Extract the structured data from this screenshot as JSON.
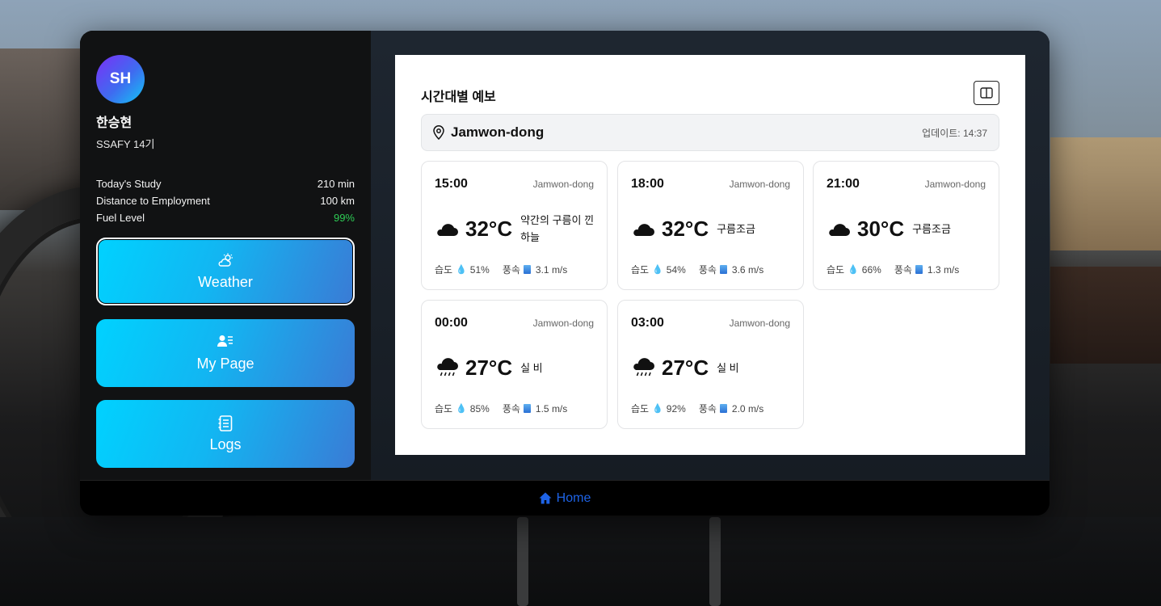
{
  "user": {
    "initials": "SH",
    "name": "한승현",
    "subtitle": "SSAFY 14기"
  },
  "stats": [
    {
      "label": "Today's Study",
      "value": "210 min"
    },
    {
      "label": "Distance to Employment",
      "value": "100 km"
    },
    {
      "label": "Fuel Level",
      "value": "99%",
      "color": "#2ecc55"
    }
  ],
  "nav": [
    {
      "label": "Weather",
      "icon": "cloud-sun-icon",
      "active": true
    },
    {
      "label": "My Page",
      "icon": "user-list-icon",
      "active": false
    },
    {
      "label": "Logs",
      "icon": "notebook-icon",
      "active": false
    }
  ],
  "forecast": {
    "title": "시간대별 예보",
    "location": "Jamwon-dong",
    "updated": "업데이트: 14:37",
    "humidity_label": "습도",
    "wind_label": "풍속",
    "items": [
      {
        "time": "15:00",
        "location": "Jamwon-dong",
        "temp": "32°C",
        "desc": "약간의 구름이 낀 하늘",
        "icon": "cloud-icon",
        "humidity": "51%",
        "wind": "3.1 m/s"
      },
      {
        "time": "18:00",
        "location": "Jamwon-dong",
        "temp": "32°C",
        "desc": "구름조금",
        "icon": "cloud-icon",
        "humidity": "54%",
        "wind": "3.6 m/s"
      },
      {
        "time": "21:00",
        "location": "Jamwon-dong",
        "temp": "30°C",
        "desc": "구름조금",
        "icon": "cloud-icon",
        "humidity": "66%",
        "wind": "1.3 m/s"
      },
      {
        "time": "00:00",
        "location": "Jamwon-dong",
        "temp": "27°C",
        "desc": "실 비",
        "icon": "rain-cloud-icon",
        "humidity": "85%",
        "wind": "1.5 m/s"
      },
      {
        "time": "03:00",
        "location": "Jamwon-dong",
        "temp": "27°C",
        "desc": "실 비",
        "icon": "rain-cloud-icon",
        "humidity": "92%",
        "wind": "2.0 m/s"
      }
    ]
  },
  "footer": {
    "label": "Home",
    "icon": "home-icon",
    "color": "#1e63e6"
  }
}
